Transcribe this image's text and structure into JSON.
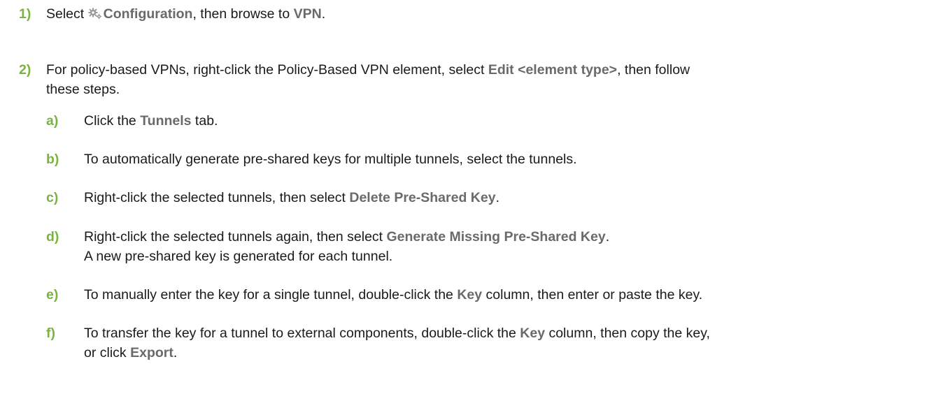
{
  "steps": [
    {
      "num": "1)",
      "parts": [
        "Select ",
        "Configuration",
        ", then browse to ",
        "VPN",
        "."
      ],
      "icon": "gear-icon"
    },
    {
      "num": "2)",
      "line1": [
        "For policy-based VPNs, right-click the Policy-Based VPN element, select ",
        "Edit <element type>",
        ", then follow"
      ],
      "line2": "these steps.",
      "substeps": [
        {
          "num": "a)",
          "parts": [
            "Click the ",
            "Tunnels",
            " tab."
          ]
        },
        {
          "num": "b)",
          "parts": [
            "To automatically generate pre-shared keys for multiple tunnels, select the tunnels."
          ]
        },
        {
          "num": "c)",
          "parts": [
            "Right-click the selected tunnels, then select ",
            "Delete Pre-Shared Key",
            "."
          ]
        },
        {
          "num": "d)",
          "parts": [
            "Right-click the selected tunnels again, then select ",
            "Generate Missing Pre-Shared Key",
            "."
          ],
          "note": "A new pre-shared key is generated for each tunnel."
        },
        {
          "num": "e)",
          "parts": [
            "To manually enter the key for a single tunnel, double-click the ",
            "Key",
            " column, then enter or paste the key."
          ]
        },
        {
          "num": "f)",
          "parts": [
            "To transfer the key for a tunnel to external components, double-click the ",
            "Key",
            " column, then copy the key,"
          ],
          "line2_parts": [
            "or click ",
            "Export",
            "."
          ]
        }
      ]
    }
  ],
  "colors": {
    "number_green": "#7ab33e",
    "ui_term_gray": "#6a6a6a",
    "body_text": "#1a1a1a"
  }
}
